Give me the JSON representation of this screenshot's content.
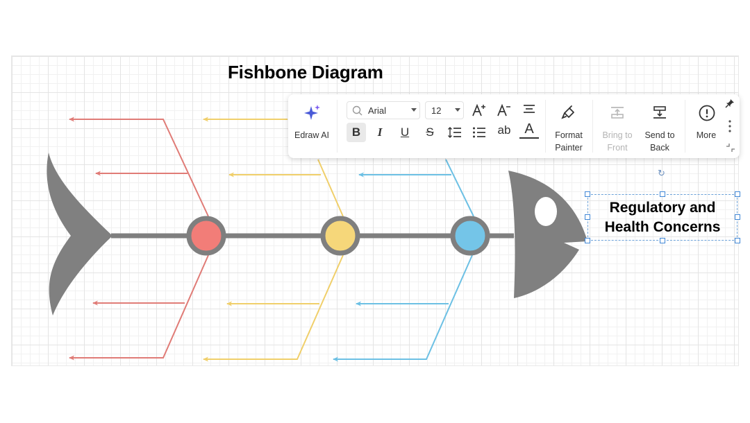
{
  "diagram": {
    "title": "Fishbone Diagram",
    "head_label": "Regulatory and Health Concerns",
    "branch_colors": [
      "#e07b76",
      "#f3d679",
      "#74c4e6"
    ],
    "spine_color": "#7f7f7f",
    "node_fills": [
      "#f27d78",
      "#f6d77a",
      "#74c5e8"
    ]
  },
  "toolbar": {
    "edraw_ai_label": "Edraw AI",
    "font_family_value": "Arial",
    "font_size_value": "12",
    "format_painter_label": "Format Painter",
    "bring_to_front_label": "Bring to Front",
    "send_to_back_label": "Send to Back",
    "more_label": "More",
    "buttons": {
      "bold": "B",
      "italic": "I",
      "underline": "U",
      "strikethrough": "S",
      "text_case": "ab",
      "font_color": "A"
    },
    "icons": [
      "sparkle-icon",
      "search-icon",
      "increase-font-icon",
      "decrease-font-icon",
      "align-icon",
      "line-spacing-icon",
      "bullet-list-icon",
      "format-painter-icon",
      "bring-to-front-icon",
      "send-to-back-icon",
      "more-icon",
      "pin-icon",
      "vertical-dots-icon",
      "collapse-icon",
      "rotate-icon"
    ]
  }
}
